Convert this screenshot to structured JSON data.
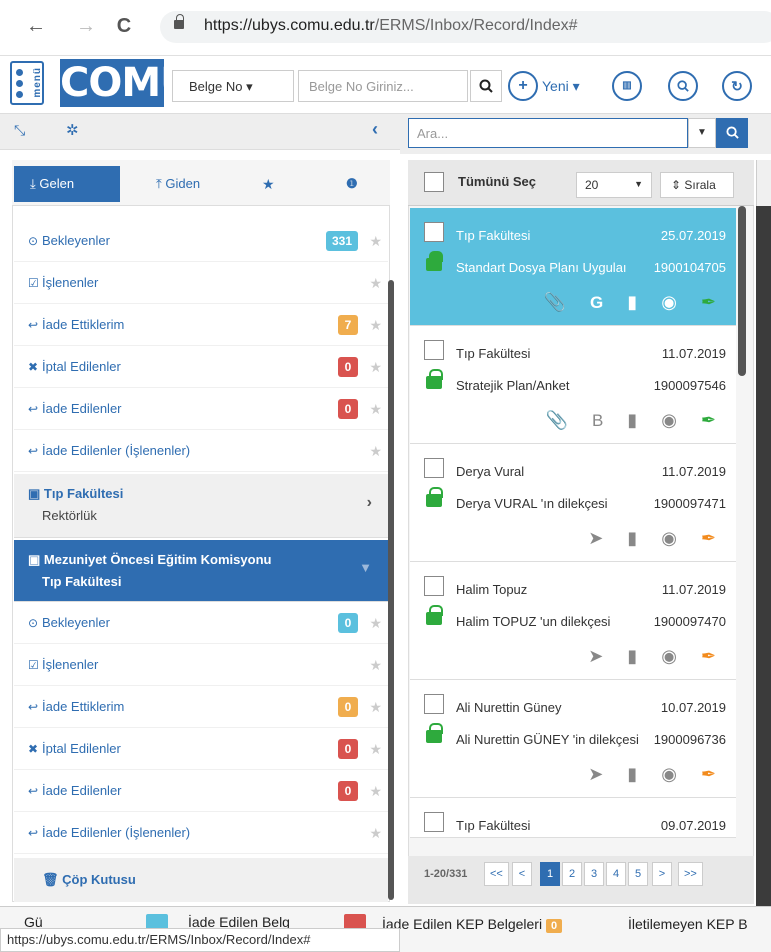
{
  "browser": {
    "back": "←",
    "forward": "→",
    "reload": "C",
    "url_host": "https://ubys.comu.edu.tr",
    "url_path": "/ERMS/Inbox/Record/Index#"
  },
  "toolbar": {
    "menu_label": "menü",
    "logo": "COMU",
    "belge_select": "Belge No ▾",
    "belge_placeholder": "Belge No Giriniz...",
    "yeni_label": "Yeni ▾"
  },
  "search": {
    "placeholder": "Ara..."
  },
  "tabs": {
    "gelen": "Gelen",
    "giden": "Giden"
  },
  "folders1": [
    {
      "label": "Bekleyenler",
      "badge": "331",
      "color": "blue",
      "icon": "⊙"
    },
    {
      "label": "İşlenenler",
      "badge": "",
      "color": "",
      "icon": "☑"
    },
    {
      "label": "İade Ettiklerim",
      "badge": "7",
      "color": "orange",
      "icon": "↩"
    },
    {
      "label": "İptal Edilenler",
      "badge": "0",
      "color": "red",
      "icon": "✖"
    },
    {
      "label": "İade Edilenler",
      "badge": "0",
      "color": "red",
      "icon": "↩"
    },
    {
      "label": "İade Edilenler (İşlenenler)",
      "badge": "",
      "color": "",
      "icon": "↩"
    }
  ],
  "group1": {
    "title": "Tıp Fakültesi",
    "sub": "Rektörlük"
  },
  "group2": {
    "title": "Mezuniyet Öncesi Eğitim Komisyonu",
    "sub": "Tıp Fakültesi"
  },
  "folders2": [
    {
      "label": "Bekleyenler",
      "badge": "0",
      "color": "blue",
      "icon": "⊙"
    },
    {
      "label": "İşlenenler",
      "badge": "",
      "color": "",
      "icon": "☑"
    },
    {
      "label": "İade Ettiklerim",
      "badge": "0",
      "color": "orange",
      "icon": "↩"
    },
    {
      "label": "İptal Edilenler",
      "badge": "0",
      "color": "red",
      "icon": "✖"
    },
    {
      "label": "İade Edilenler",
      "badge": "0",
      "color": "red",
      "icon": "↩"
    },
    {
      "label": "İade Edilenler (İşlenenler)",
      "badge": "",
      "color": "",
      "icon": "↩"
    }
  ],
  "trash": "Çöp Kutusu",
  "list": {
    "select_all": "Tümünü Seç",
    "page_size": "20",
    "sort": "Sırala",
    "items": [
      {
        "from": "Tıp Fakültesi",
        "date": "25.07.2019",
        "subject": "Standart Dosya Planı Uygulaı",
        "number": "1900104705",
        "letter": "G",
        "selected": true
      },
      {
        "from": "Tıp Fakültesi",
        "date": "11.07.2019",
        "subject": "Stratejik Plan/Anket",
        "number": "1900097546",
        "letter": "B",
        "selected": false
      },
      {
        "from": "Derya Vural",
        "date": "11.07.2019",
        "subject": "Derya VURAL 'ın dilekçesi",
        "number": "1900097471",
        "letter": "",
        "selected": false
      },
      {
        "from": "Halim Topuz",
        "date": "11.07.2019",
        "subject": "Halim TOPUZ 'un dilekçesi",
        "number": "1900097470",
        "letter": "",
        "selected": false
      },
      {
        "from": "Ali Nurettin Güney",
        "date": "10.07.2019",
        "subject": "Ali Nurettin GÜNEY 'in dilekçesi",
        "number": "1900096736",
        "letter": "",
        "selected": false
      },
      {
        "from": "Tıp Fakültesi",
        "date": "09.07.2019",
        "subject": "",
        "number": "",
        "letter": "",
        "selected": false
      }
    ],
    "page_info": "1-20/331",
    "pages": [
      "<<",
      "<",
      "1",
      "2",
      "3",
      "4",
      "5",
      ">",
      ">>"
    ]
  },
  "bottom": {
    "item1": "Gü",
    "item2": "İade Edilen Belg",
    "item3": "İade Edilen KEP Belgeleri",
    "item3_badge": "0",
    "item4": "İletilemeyen KEP B",
    "status_url": "https://ubys.comu.edu.tr/ERMS/Inbox/Record/Index#"
  }
}
